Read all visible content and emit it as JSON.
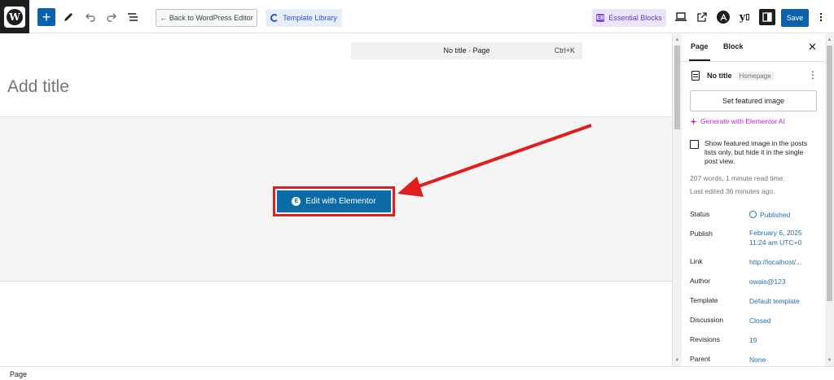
{
  "toolbar": {
    "logo_letter": "W",
    "add_symbol": "+",
    "back_label": "← Back to WordPress Editor",
    "template_library_label": "Template Library",
    "essential_blocks_label": "Essential Blocks",
    "essential_blocks_badge": "EB",
    "yoast_label": "y",
    "save_label": "Save"
  },
  "command_bar": {
    "title": "No title · Page",
    "shortcut": "Ctrl+K"
  },
  "editor": {
    "title_placeholder": "Add title",
    "elementor_button_label": "Edit with Elementor",
    "elementor_icon_letter": "E",
    "annotation_color": "#e11e1e"
  },
  "sidebar": {
    "tabs": [
      {
        "label": "Page",
        "active": true
      },
      {
        "label": "Block",
        "active": false
      }
    ],
    "close_symbol": "✕",
    "document": {
      "title": "No title",
      "badge": "Homepage",
      "more_symbol": "⋮"
    },
    "featured_image_button": "Set featured image",
    "ai_link": "Generate with Elementor AI",
    "checkbox_text": "Show featured image in the posts lists only, but hide it in the single post view.",
    "read_time": "207 words, 1 minute read time.",
    "last_edited": "Last edited 36 minutes ago.",
    "properties": [
      {
        "label": "Status",
        "value": "Published"
      },
      {
        "label": "Publish",
        "value": "February 6, 2025",
        "value2": "11:24 am UTC+0"
      },
      {
        "label": "Link",
        "value": "http://localhost/..."
      },
      {
        "label": "Author",
        "value": "owais@123"
      },
      {
        "label": "Template",
        "value": "Default template"
      },
      {
        "label": "Discussion",
        "value": "Closed"
      },
      {
        "label": "Revisions",
        "value": "19"
      },
      {
        "label": "Parent",
        "value": "None"
      }
    ]
  },
  "footer": {
    "breadcrumb": "Page"
  },
  "colors": {
    "primary_blue": "#0a63aa",
    "elementor_blue": "#0b6ba6",
    "link_blue": "#2271b1",
    "ai_magenta": "#c026d3"
  }
}
